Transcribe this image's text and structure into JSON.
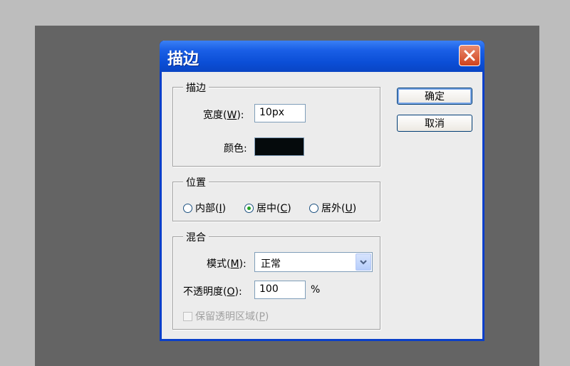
{
  "dialog": {
    "title": "描边",
    "ok_label": "确定",
    "cancel_label": "取消"
  },
  "stroke": {
    "group_title": "描边",
    "width_label_pre": "宽度(",
    "width_label_key": "W",
    "width_label_post": "):",
    "width_value": "10px",
    "color_label": "颜色:",
    "color": "#050a0c"
  },
  "position": {
    "group_title": "位置",
    "options": [
      {
        "pre": "内部(",
        "key": "I",
        "post": ")",
        "selected": false
      },
      {
        "pre": "居中(",
        "key": "C",
        "post": ")",
        "selected": true
      },
      {
        "pre": "居外(",
        "key": "U",
        "post": ")",
        "selected": false
      }
    ]
  },
  "blend": {
    "group_title": "混合",
    "mode_label_pre": "模式(",
    "mode_label_key": "M",
    "mode_label_post": "):",
    "mode_value": "正常",
    "opacity_label_pre": "不透明度(",
    "opacity_label_key": "O",
    "opacity_label_post": "):",
    "opacity_value": "100",
    "opacity_unit": "%",
    "preserve_label_pre": "保留透明区域(",
    "preserve_label_key": "P",
    "preserve_label_post": ")"
  },
  "colors": {
    "titlebar": "#0b4ed6",
    "radio_selected": "#21a121"
  }
}
